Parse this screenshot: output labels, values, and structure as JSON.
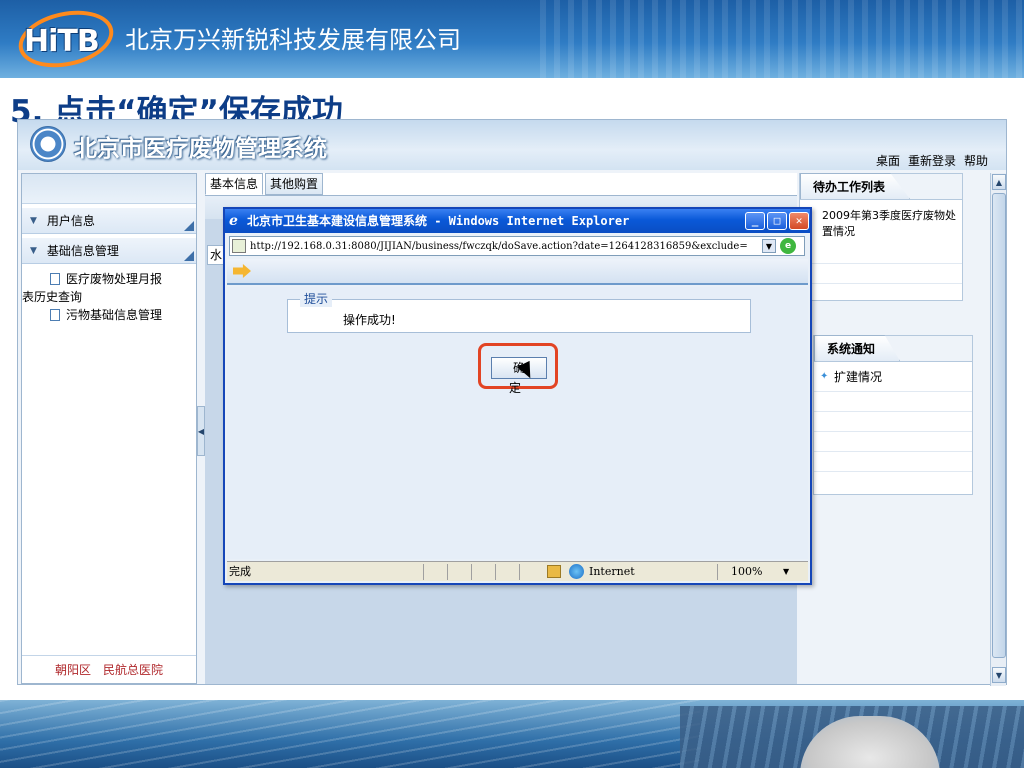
{
  "slide": {
    "company_name": "北京万兴新锐科技发展有限公司",
    "logo_text": "HiTB",
    "step_title": "5. 点击“确定”保存成功"
  },
  "app": {
    "title": "北京市医疗废物管理系统",
    "top_links": [
      "桌面",
      "重新登录",
      "帮助"
    ],
    "sidebar": {
      "sections": [
        {
          "label": "用户信息"
        },
        {
          "label": "基础信息管理"
        }
      ],
      "leaf_items": [
        {
          "label_line1": "医疗废物处理月报",
          "label_line2": "表历史查询"
        },
        {
          "label_line1": "污物基础信息管理",
          "label_line2": ""
        }
      ],
      "footer": {
        "district": "朝阳区",
        "hospital": "民航总医院"
      }
    },
    "tabs": [
      "基本信息",
      "其他购置"
    ],
    "water_label": "水",
    "todo_panel": {
      "title": "待办工作列表",
      "items": [
        "2009年第3季度医疗废物处置情况"
      ]
    },
    "notice_panel": {
      "title": "系统通知",
      "items": [
        "扩建情况"
      ]
    }
  },
  "popup": {
    "window_title": "北京市卫生基本建设信息管理系统 - Windows Internet Explorer",
    "url": "http://192.168.0.31:8080/JIJIAN/business/fwczqk/doSave.action?date=1264128316859&exclude=",
    "fieldset_legend": "提示",
    "message": "操作成功!",
    "ok_button": "确 定",
    "status_done": "完成",
    "status_zone": "Internet",
    "status_zoom": "100%"
  },
  "colors": {
    "title_blue": "#0d3d87",
    "highlight_red": "#e24424",
    "ie_titlebar": "#0a59d8",
    "footer_red": "#b0282c"
  }
}
